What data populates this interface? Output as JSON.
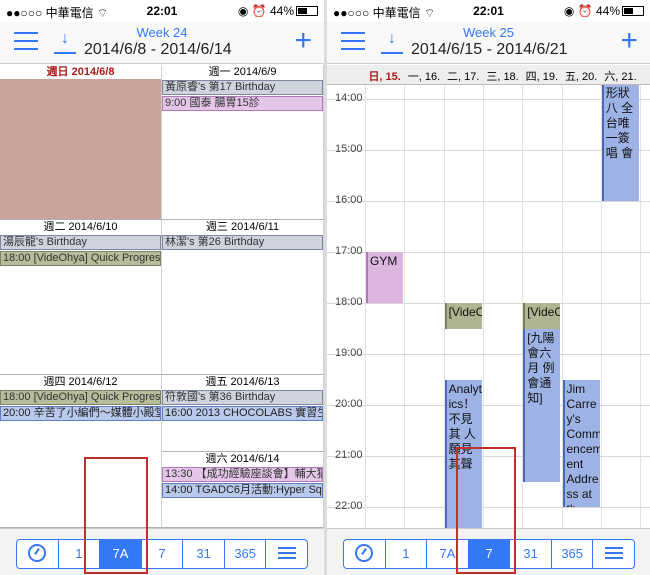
{
  "status": {
    "carrier": "中華電信",
    "time": "22:01",
    "battery": "44%"
  },
  "left": {
    "week_label": "Week 24",
    "range": "2014/6/8 - 2014/6/14",
    "days": [
      {
        "header": "週日 2014/6/8",
        "events": []
      },
      {
        "header": "週一 2014/6/9",
        "events": [
          {
            "text": "黃原睿's 第17 Birthday",
            "color": "gray"
          },
          {
            "text": "9:00 國泰 腸胃15診",
            "color": "pink"
          }
        ]
      },
      {
        "header": "週二 2014/6/10",
        "events": [
          {
            "text": "湯辰龍's Birthday",
            "color": "gray"
          },
          {
            "text": "18:00 [VideOhya] Quick Progress",
            "color": "olive"
          }
        ]
      },
      {
        "header": "週三 2014/6/11",
        "events": [
          {
            "text": "林潔's 第26 Birthday",
            "color": "gray"
          }
        ]
      },
      {
        "header": "週四 2014/6/12",
        "events": [
          {
            "text": "18:00 [VideOhya] Quick Progress",
            "color": "olive"
          },
          {
            "text": "20:00 辛苦了小編們～媒體小殿堂",
            "color": "blue"
          }
        ]
      },
      {
        "header": "週五 2014/6/13",
        "events": [
          {
            "text": "符敦國's 第36 Birthday",
            "color": "gray"
          },
          {
            "text": "16:00 2013 CHOCOLABS 實習生",
            "color": "blue"
          }
        ]
      },
      {
        "header": "週六 2014/6/14",
        "events": [
          {
            "text": "13:30 【成功經驗座談會】輔大猶",
            "color": "pink"
          },
          {
            "text": "14:00 TGADC6月活動:Hyper Squ",
            "color": "blue"
          }
        ]
      }
    ],
    "tabs": [
      "1",
      "7A",
      "7",
      "31",
      "365"
    ],
    "selected": "7A"
  },
  "right": {
    "week_label": "Week 25",
    "range": "2014/6/15 - 2014/6/21",
    "day_headers": [
      "日, 15.",
      "一, 16.",
      "二, 17.",
      "三, 18.",
      "四, 19.",
      "五, 20.",
      "六, 21."
    ],
    "hours": [
      "14:00",
      "15:00",
      "16:00",
      "17:00",
      "18:00",
      "19:00",
      "20:00",
      "21:00",
      "22:00"
    ],
    "events": [
      {
        "text": "形狀八 全台唯 一簽唱 會",
        "day": 6,
        "start": 13.7,
        "end": 16.0,
        "color": "blue"
      },
      {
        "text": "GYM",
        "day": 0,
        "start": 17.0,
        "end": 18.0,
        "color": "pink"
      },
      {
        "text": "[VideO",
        "day": 2,
        "start": 18.0,
        "end": 18.5,
        "color": "olive"
      },
      {
        "text": "[VideO",
        "day": 4,
        "start": 18.0,
        "end": 18.5,
        "color": "olive"
      },
      {
        "text": "[九陽 會六月 例會通 知]",
        "day": 4,
        "start": 18.5,
        "end": 21.5,
        "color": "blue"
      },
      {
        "text": "Analyt ics！ 不見其 人願見 其聲",
        "day": 2,
        "start": 19.5,
        "end": 22.5,
        "color": "blue"
      },
      {
        "text": "Jim Carre y's Comm encem ent Addre ss at th",
        "day": 5,
        "start": 19.5,
        "end": 22.0,
        "color": "blue"
      }
    ],
    "tabs": [
      "1",
      "7A",
      "7",
      "31",
      "365"
    ],
    "selected": "7"
  }
}
